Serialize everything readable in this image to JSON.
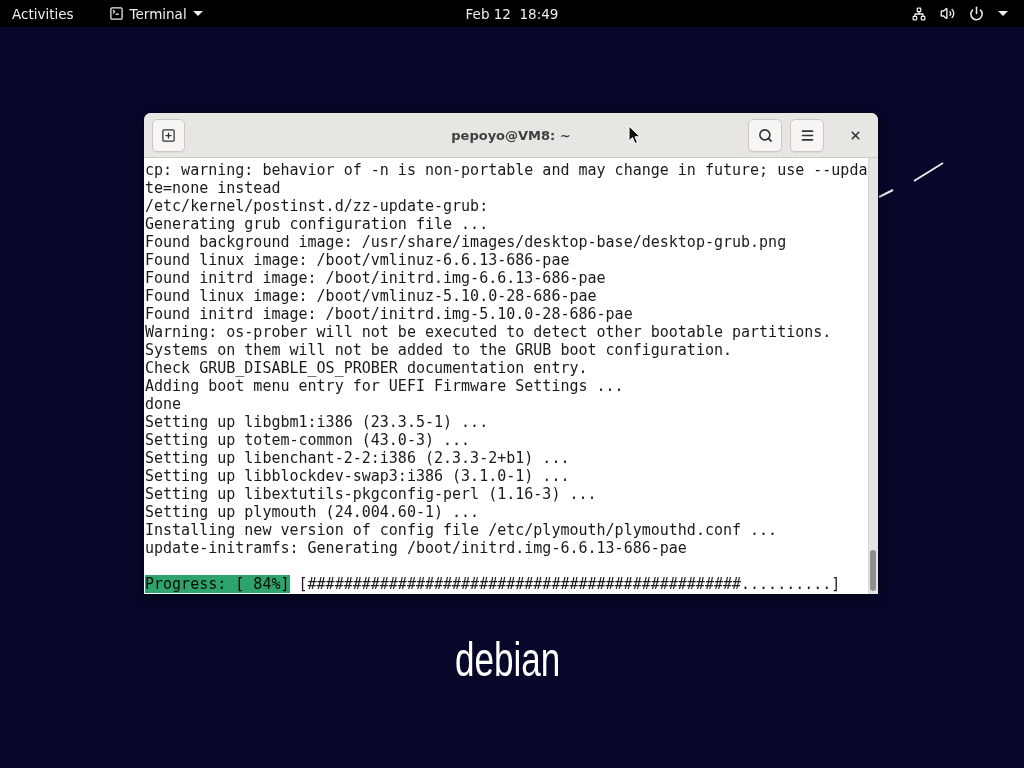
{
  "top_bar": {
    "activities": "Activities",
    "app_menu": {
      "label": "Terminal"
    },
    "clock": "Feb 12  18:49"
  },
  "window": {
    "title": "pepoyo@VM8: ~"
  },
  "terminal": {
    "lines": [
      "cp: warning: behavior of -n is non-portable and may change in future; use --update=none instead",
      "/etc/kernel/postinst.d/zz-update-grub:",
      "Generating grub configuration file ...",
      "Found background image: /usr/share/images/desktop-base/desktop-grub.png",
      "Found linux image: /boot/vmlinuz-6.6.13-686-pae",
      "Found initrd image: /boot/initrd.img-6.6.13-686-pae",
      "Found linux image: /boot/vmlinuz-5.10.0-28-686-pae",
      "Found initrd image: /boot/initrd.img-5.10.0-28-686-pae",
      "Warning: os-prober will not be executed to detect other bootable partitions.",
      "Systems on them will not be added to the GRUB boot configuration.",
      "Check GRUB_DISABLE_OS_PROBER documentation entry.",
      "Adding boot menu entry for UEFI Firmware Settings ...",
      "done",
      "Setting up libgbm1:i386 (23.3.5-1) ...",
      "Setting up totem-common (43.0-3) ...",
      "Setting up libenchant-2-2:i386 (2.3.3-2+b1) ...",
      "Setting up libblockdev-swap3:i386 (3.1.0-1) ...",
      "Setting up libextutils-pkgconfig-perl (1.16-3) ...",
      "Setting up plymouth (24.004.60-1) ...",
      "Installing new version of config file /etc/plymouth/plymouthd.conf ...",
      "update-initramfs: Generating /boot/initrd.img-6.6.13-686-pae"
    ],
    "progress": {
      "label": "Progress: [ 84%]",
      "bar": "[################################################..........]"
    }
  },
  "desktop": {
    "logo": "debian"
  }
}
